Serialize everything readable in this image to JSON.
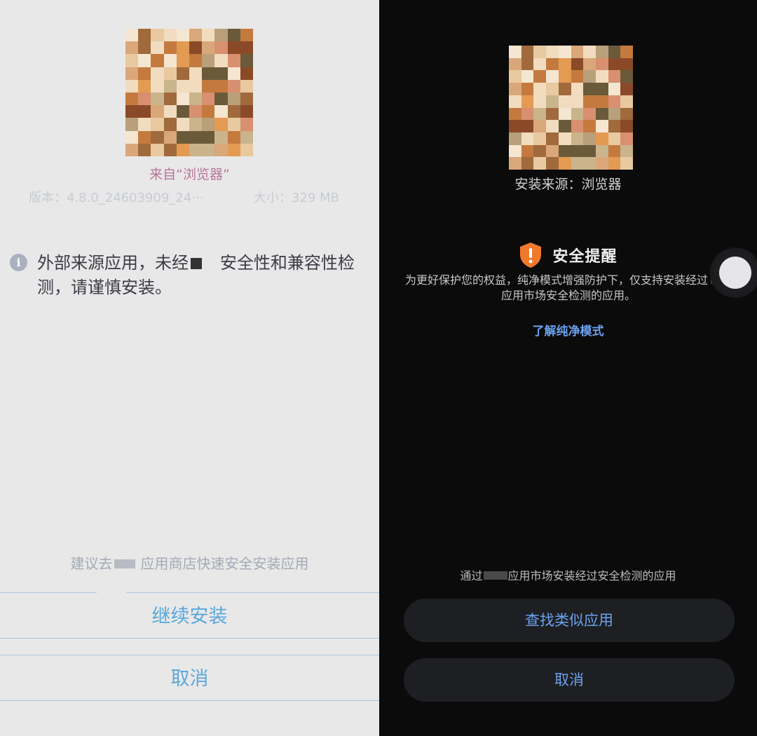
{
  "left_panel": {
    "source_text": "来自“浏览器”",
    "version_text": "版本：4.8.0_24603909_24···",
    "size_text": "大小：329 MB",
    "warning_part1": "外部来源应用，未经",
    "warning_part2": "安全性和兼容性检测，请谨慎安装。",
    "suggest_part1": "建议去",
    "suggest_part2": "应用商店快速安全安装应用",
    "continue_label": "继续安装",
    "cancel_label": "取消",
    "colors": {
      "background": "#e8e8e8",
      "accent": "#5aa7dc",
      "source": "#b9749a"
    }
  },
  "right_panel": {
    "source_text": "安装来源：浏览器",
    "alert_title": "安全提醒",
    "alert_desc_part1": "为更好保护您的权益，纯净模式增强防护下，仅支持安装经过",
    "alert_desc_part2": "应用市场安全检测的应用。",
    "learn_more": "了解纯净模式",
    "tip_part1": "通过",
    "tip_part2": "应用市场安装经过安全检测的应用",
    "find_similar_label": "查找类似应用",
    "cancel_label": "取消",
    "colors": {
      "background": "#0b0b0c",
      "accent": "#6aa2ef",
      "shield": "#f07a2c"
    }
  },
  "icons": [
    "info-icon",
    "shield-warning-icon",
    "floating-ball-icon"
  ]
}
